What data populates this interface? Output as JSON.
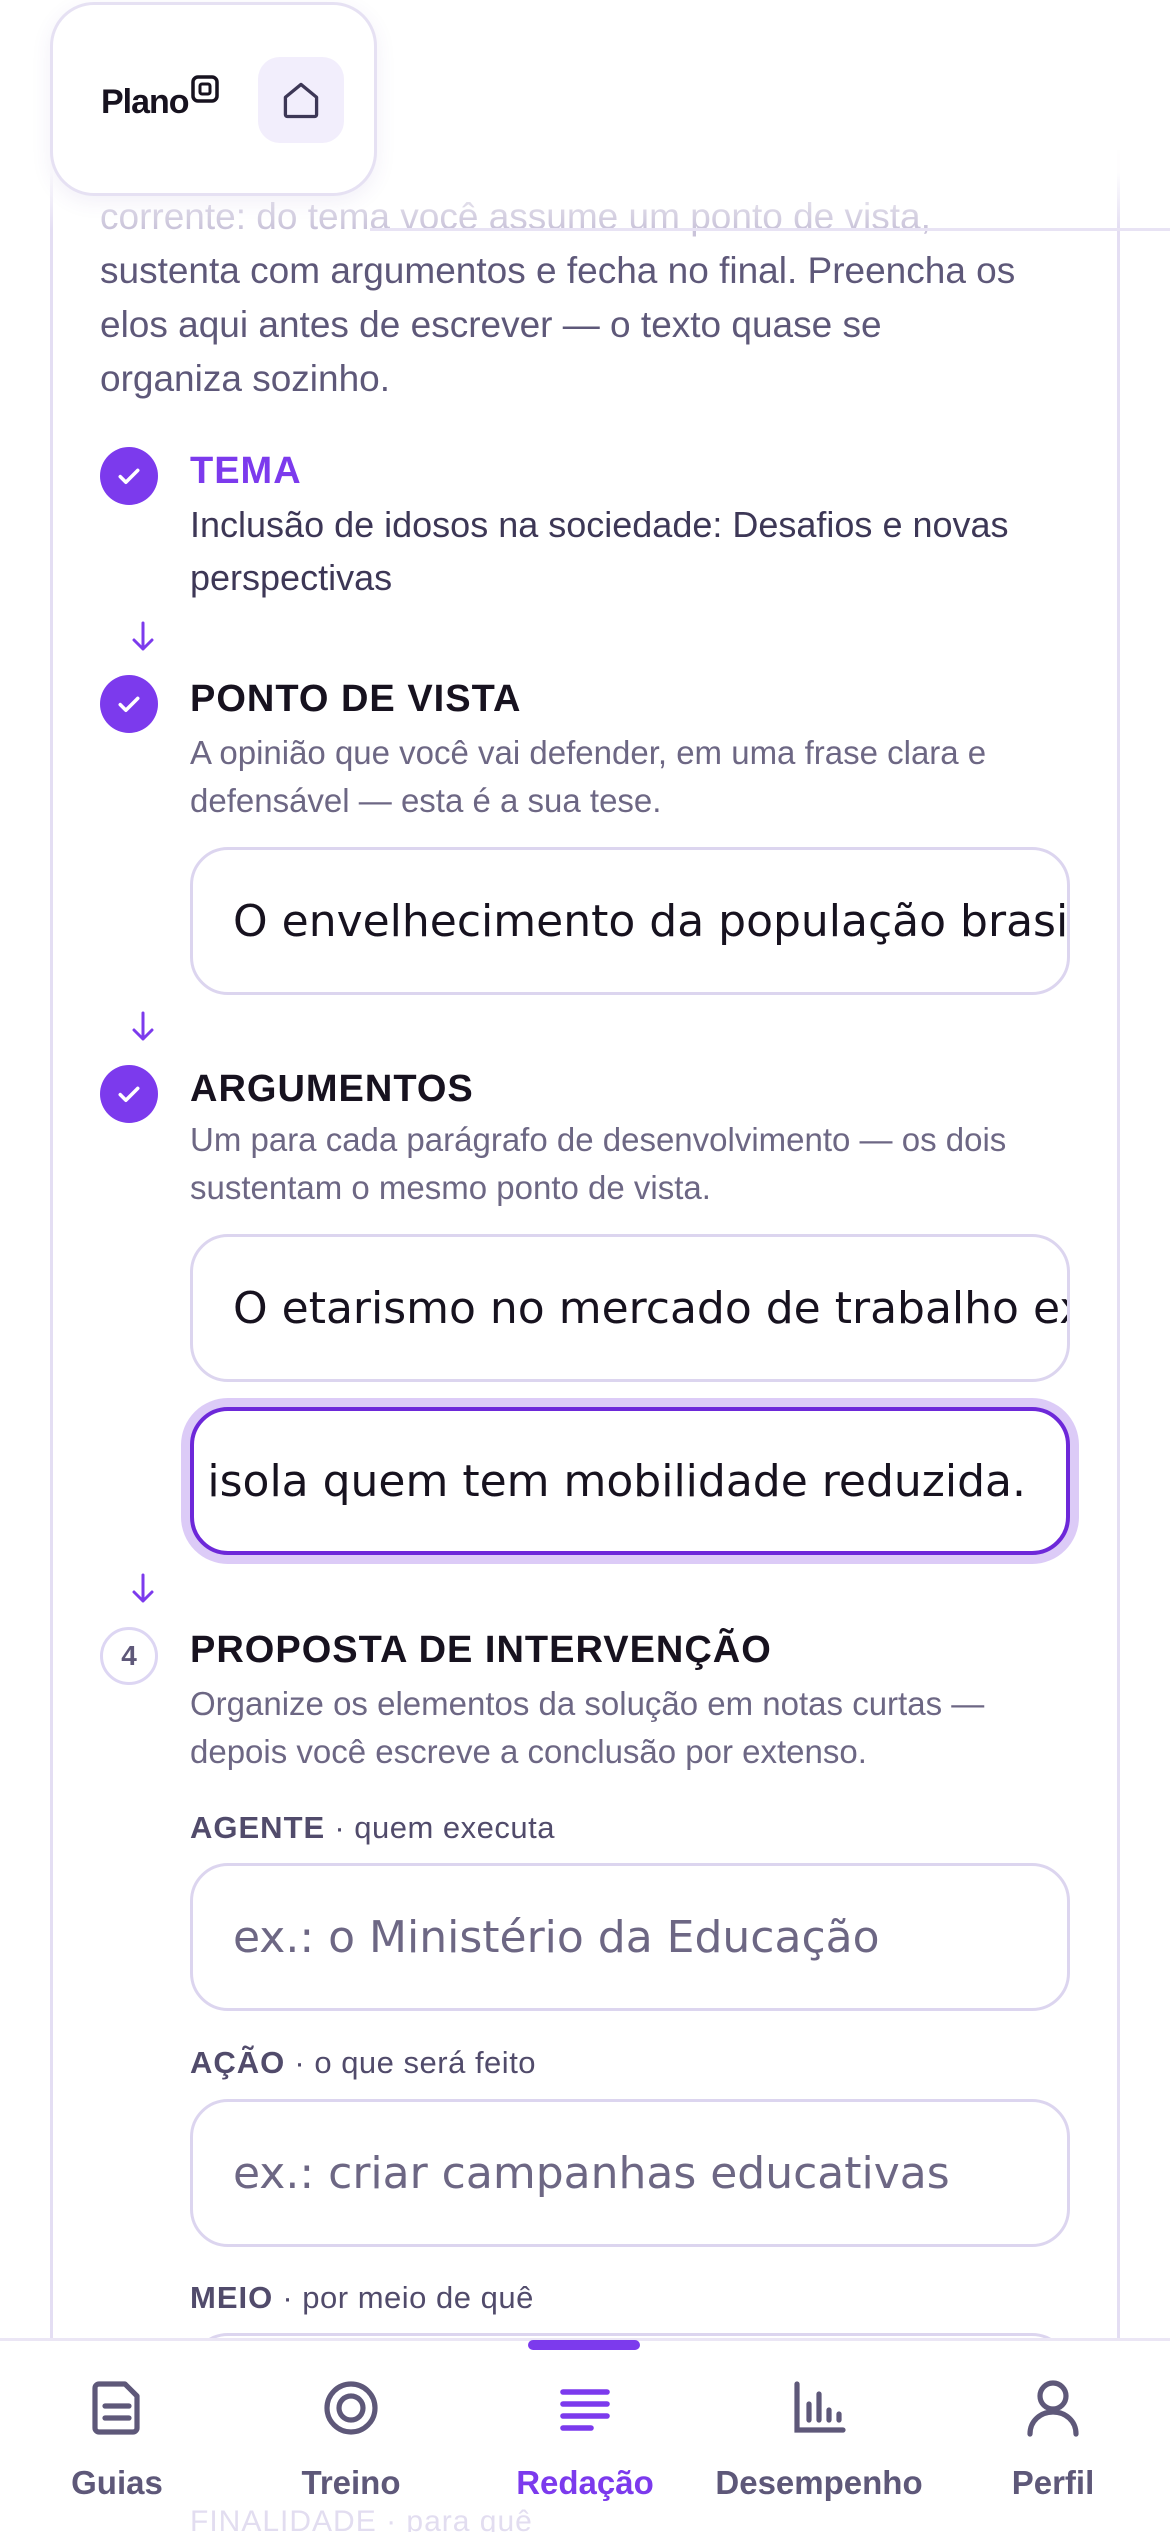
{
  "header": {
    "logo_text": "Plano",
    "home_icon": "home-icon"
  },
  "intro": {
    "faded_line": "corrente: do tema você assume um ponto de vista,",
    "lines": [
      "sustenta com argumentos e fecha no final. Preencha os",
      "elos aqui antes de escrever — o texto quase se",
      "organiza sozinho."
    ]
  },
  "steps": {
    "tema": {
      "title": "TEMA",
      "text": "Inclusão de idosos na sociedade: Desafios e novas perspectivas",
      "status": "completed"
    },
    "ponto_de_vista": {
      "title": "PONTO DE VISTA",
      "description": "A opinião que você vai defender, em uma frase clara e defensável — esta é a sua tese.",
      "value": "O envelhecimento da população brasileira",
      "status": "completed"
    },
    "argumentos": {
      "title": "ARGUMENTOS",
      "description": "Um para cada parágrafo de desenvolvimento — os dois sustentam o mesmo ponto de vista.",
      "values": [
        "O etarismo no mercado de trabalho exclui",
        "isola quem tem mobilidade reduzida."
      ],
      "status": "completed"
    },
    "proposta": {
      "number": "4",
      "title": "PROPOSTA DE INTERVENÇÃO",
      "description": "Organize os elementos da solução em notas curtas — depois você escreve a conclusão por extenso.",
      "fields": {
        "agente": {
          "label": "AGENTE",
          "hint": "· quem executa",
          "placeholder": "ex.: o Ministério da Educação"
        },
        "acao": {
          "label": "AÇÃO",
          "hint": "· o que será feito",
          "placeholder": "ex.: criar campanhas educativas"
        },
        "meio": {
          "label": "MEIO",
          "hint": "· por meio de quê"
        },
        "finalidade": {
          "label": "FINALIDADE",
          "hint": "· para quê"
        }
      }
    }
  },
  "nav": {
    "items": [
      {
        "label": "Guias",
        "icon": "document-icon",
        "active": false
      },
      {
        "label": "Treino",
        "icon": "target-icon",
        "active": false
      },
      {
        "label": "Redação",
        "icon": "text-lines-icon",
        "active": true
      },
      {
        "label": "Desempenho",
        "icon": "bar-chart-icon",
        "active": false
      },
      {
        "label": "Perfil",
        "icon": "user-icon",
        "active": false
      }
    ]
  },
  "colors": {
    "accent": "#7c3aed",
    "text": "#17121f",
    "muted": "#6d6784",
    "border": "#dcd5ef"
  }
}
